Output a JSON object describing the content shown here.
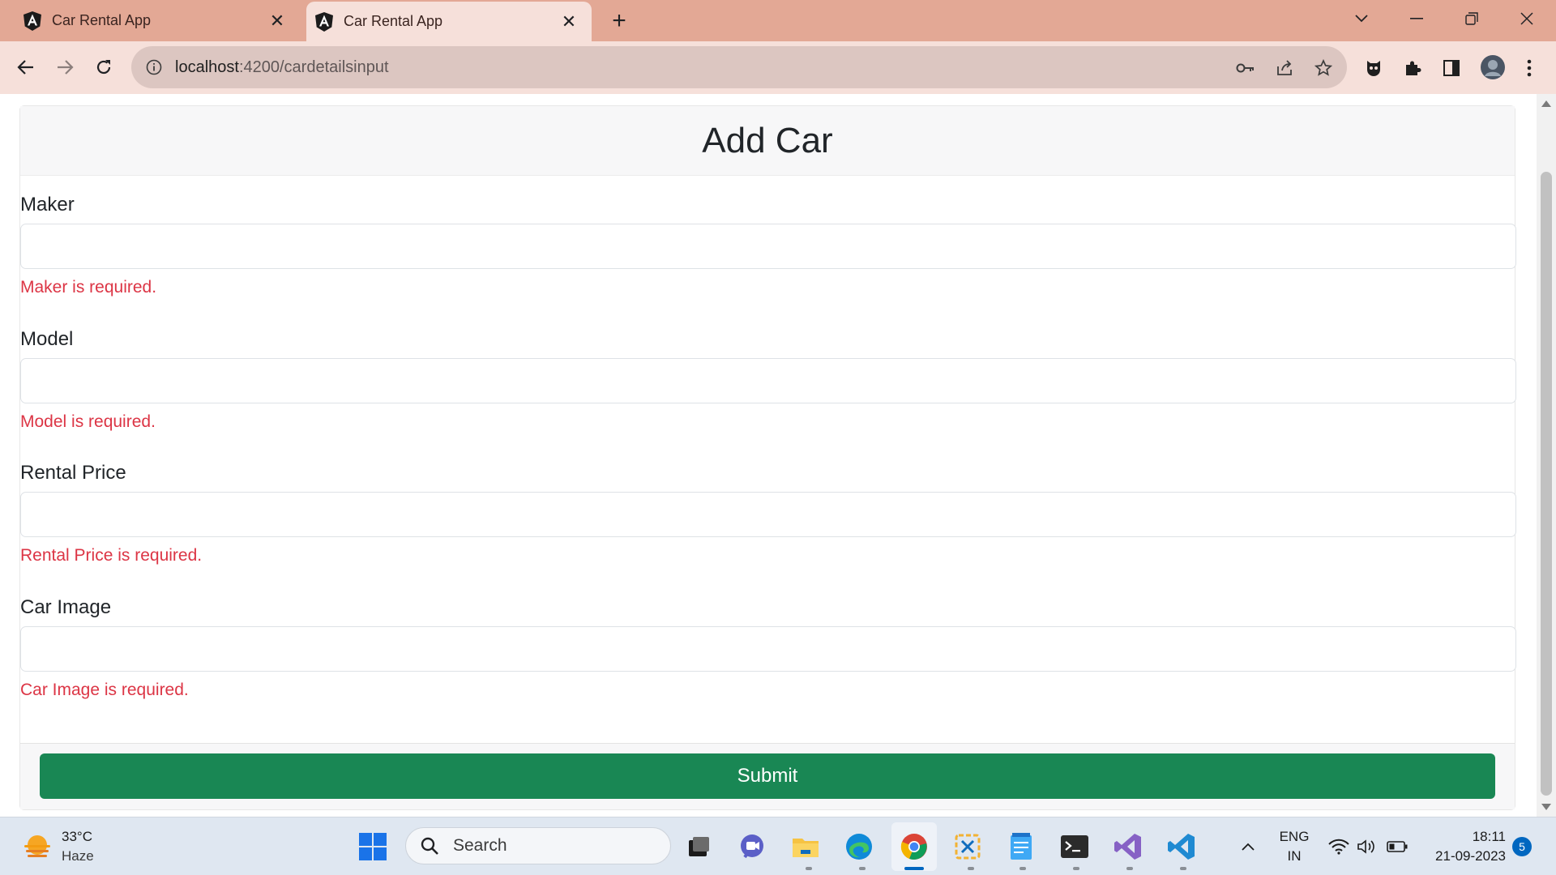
{
  "browser": {
    "tabs": [
      {
        "title": "Car Rental App",
        "active": false
      },
      {
        "title": "Car Rental App",
        "active": true
      }
    ],
    "url_host": "localhost",
    "url_path": ":4200/cardetailsinput"
  },
  "page": {
    "title": "Add Car",
    "fields": [
      {
        "label": "Maker",
        "value": "",
        "error": "Maker is required."
      },
      {
        "label": "Model",
        "value": "",
        "error": "Model is required."
      },
      {
        "label": "Rental Price",
        "value": "",
        "error": "Rental Price is required."
      },
      {
        "label": "Car Image",
        "value": "",
        "error": "Car Image is required."
      }
    ],
    "submit_label": "Submit"
  },
  "taskbar": {
    "weather_temp": "33°C",
    "weather_desc": "Haze",
    "search_placeholder": "Search",
    "lang_top": "ENG",
    "lang_bottom": "IN",
    "time": "18:11",
    "date": "21-09-2023",
    "notification_count": "5"
  },
  "colors": {
    "tab_bar": "#e3a895",
    "toolbar": "#f6e0da",
    "error": "#dc3545",
    "submit": "#198754"
  }
}
